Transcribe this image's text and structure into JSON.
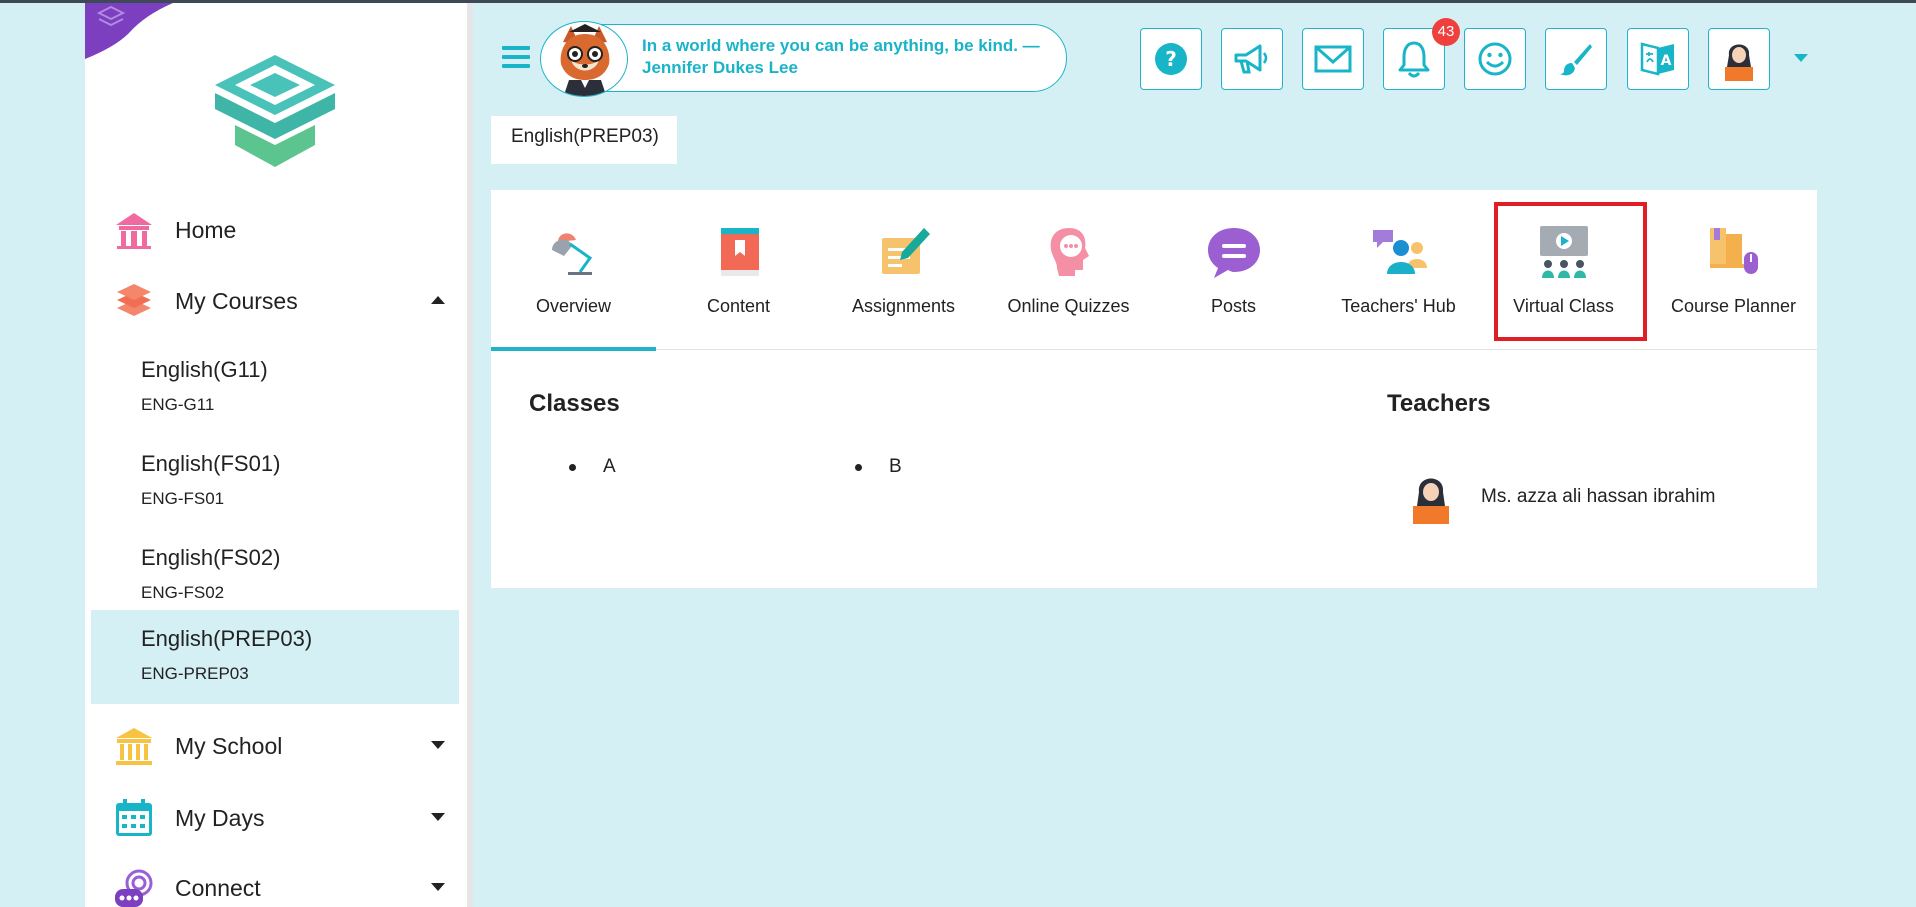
{
  "header": {
    "quote": "In a world where you can be anything, be kind. — Jennifer Dukes Lee",
    "notification_count": "43",
    "buttons": [
      "help-icon",
      "megaphone-icon",
      "mail-icon",
      "bell-icon",
      "smiley-icon",
      "brush-icon",
      "translate-icon",
      "profile-icon"
    ]
  },
  "sidebar": {
    "home": "Home",
    "my_courses": "My Courses",
    "courses": [
      {
        "name": "English(G11)",
        "code": "ENG-G11"
      },
      {
        "name": "English(FS01)",
        "code": "ENG-FS01"
      },
      {
        "name": "English(FS02)",
        "code": "ENG-FS02"
      },
      {
        "name": "English(PREP03)",
        "code": "ENG-PREP03"
      }
    ],
    "my_school": "My School",
    "my_days": "My Days",
    "connect": "Connect"
  },
  "breadcrumb": "English(PREP03)",
  "tabs": [
    {
      "label": "Overview"
    },
    {
      "label": "Content"
    },
    {
      "label": "Assignments"
    },
    {
      "label": "Online Quizzes"
    },
    {
      "label": "Posts"
    },
    {
      "label": "Teachers' Hub"
    },
    {
      "label": "Virtual Class"
    },
    {
      "label": "Course Planner"
    }
  ],
  "classes": {
    "title": "Classes",
    "items": [
      "A",
      "B"
    ]
  },
  "teachers": {
    "title": "Teachers",
    "items": [
      "Ms. azza ali hassan ibrahim"
    ]
  },
  "colors": {
    "accent": "#1fb4c9",
    "background": "#d4f0f4",
    "highlight": "#e01e26",
    "badge": "#f0403e"
  }
}
